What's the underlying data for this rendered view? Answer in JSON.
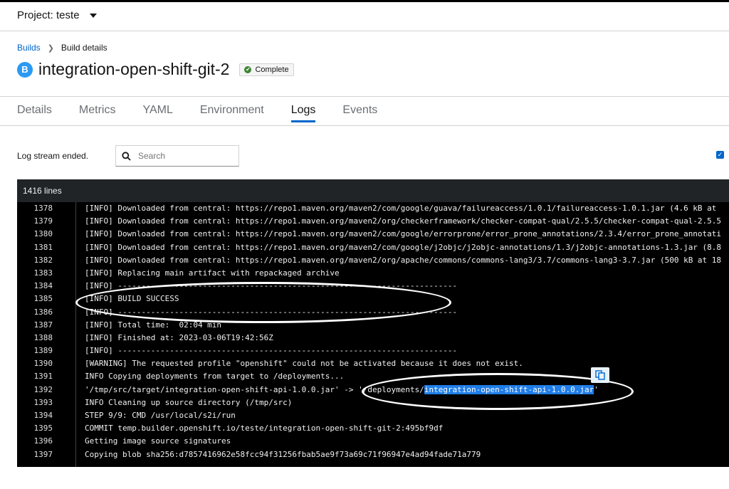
{
  "project": {
    "label": "Project: teste"
  },
  "breadcrumb": {
    "root": "Builds",
    "current": "Build details"
  },
  "header": {
    "badge": "B",
    "title": "integration-open-shift-git-2",
    "status": "Complete"
  },
  "tabs": [
    "Details",
    "Metrics",
    "YAML",
    "Environment",
    "Logs",
    "Events"
  ],
  "active_tab": "Logs",
  "toolbar": {
    "stream_status": "Log stream ended.",
    "search_placeholder": "Search"
  },
  "log": {
    "line_count": "1416 lines",
    "lines": [
      {
        "n": "1378",
        "text": "[INFO] Downloaded from central: https://repo1.maven.org/maven2/com/google/guava/failureaccess/1.0.1/failureaccess-1.0.1.jar (4.6 kB at"
      },
      {
        "n": "1379",
        "text": "[INFO] Downloaded from central: https://repo1.maven.org/maven2/org/checkerframework/checker-compat-qual/2.5.5/checker-compat-qual-2.5.5"
      },
      {
        "n": "1380",
        "text": "[INFO] Downloaded from central: https://repo1.maven.org/maven2/com/google/errorprone/error_prone_annotations/2.3.4/error_prone_annotati"
      },
      {
        "n": "1381",
        "text": "[INFO] Downloaded from central: https://repo1.maven.org/maven2/com/google/j2objc/j2objc-annotations/1.3/j2objc-annotations-1.3.jar (8.8"
      },
      {
        "n": "1382",
        "text": "[INFO] Downloaded from central: https://repo1.maven.org/maven2/org/apache/commons/commons-lang3/3.7/commons-lang3-3.7.jar (500 kB at 18"
      },
      {
        "n": "1383",
        "text": "[INFO] Replacing main artifact with repackaged archive"
      },
      {
        "n": "1384",
        "text": "[INFO] ------------------------------------------------------------------------"
      },
      {
        "n": "1385",
        "text": "[INFO] BUILD SUCCESS"
      },
      {
        "n": "1386",
        "text": "[INFO] ------------------------------------------------------------------------"
      },
      {
        "n": "1387",
        "text": "[INFO] Total time:  02:04 min"
      },
      {
        "n": "1388",
        "text": "[INFO] Finished at: 2023-03-06T19:42:56Z"
      },
      {
        "n": "1389",
        "text": "[INFO] ------------------------------------------------------------------------"
      },
      {
        "n": "1390",
        "text": "[WARNING] The requested profile \"openshift\" could not be activated because it does not exist."
      },
      {
        "n": "1391",
        "text": "INFO Copying deployments from target to /deployments..."
      },
      {
        "n": "1392",
        "text": "'/tmp/src/target/integration-open-shift-api-1.0.0.jar' -> '/deployments/",
        "highlight": "integration-open-shift-api-1.0.0.jar",
        "after": "'"
      },
      {
        "n": "1393",
        "text": "INFO Cleaning up source directory (/tmp/src)"
      },
      {
        "n": "1394",
        "text": "STEP 9/9: CMD /usr/local/s2i/run"
      },
      {
        "n": "1395",
        "text": "COMMIT temp.builder.openshift.io/teste/integration-open-shift-git-2:495bf9df"
      },
      {
        "n": "1396",
        "text": "Getting image source signatures"
      },
      {
        "n": "1397",
        "text": "Copying blob sha256:d7857416962e58fcc94f31256fbab5ae9f73a69c71f96947e4ad94fade71a779"
      }
    ]
  }
}
